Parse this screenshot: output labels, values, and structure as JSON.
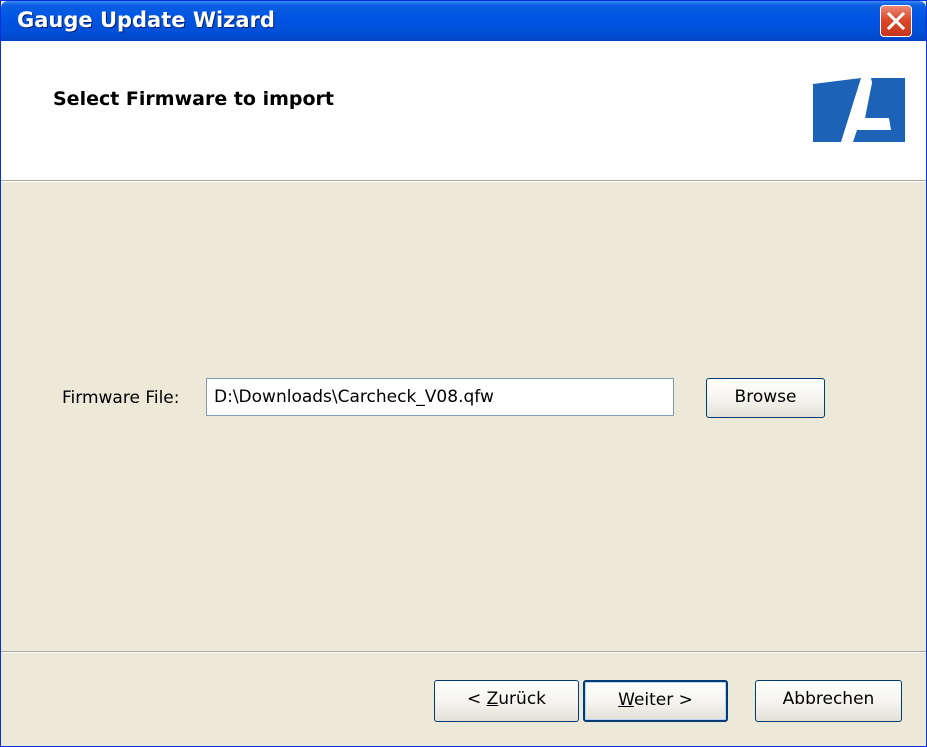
{
  "window": {
    "title": "Gauge Update Wizard",
    "close_icon": "close-icon"
  },
  "header": {
    "title": "Select Firmware to import",
    "logo_icon": "brand-logo",
    "logo_color": "#1c63b7"
  },
  "form": {
    "firmware_label": "Firmware File:",
    "firmware_value": "D:\\Downloads\\Carcheck_V08.qfw",
    "browse_label": "Browse"
  },
  "footer": {
    "back_prefix": "< ",
    "back_accel": "Z",
    "back_rest": "urück",
    "next_accel": "W",
    "next_rest": "eiter >",
    "cancel_label": "Abbrechen"
  },
  "colors": {
    "titlebar": "#0054e3",
    "dialog_bg": "#ece9d8",
    "close_button": "#dc4a2c"
  }
}
